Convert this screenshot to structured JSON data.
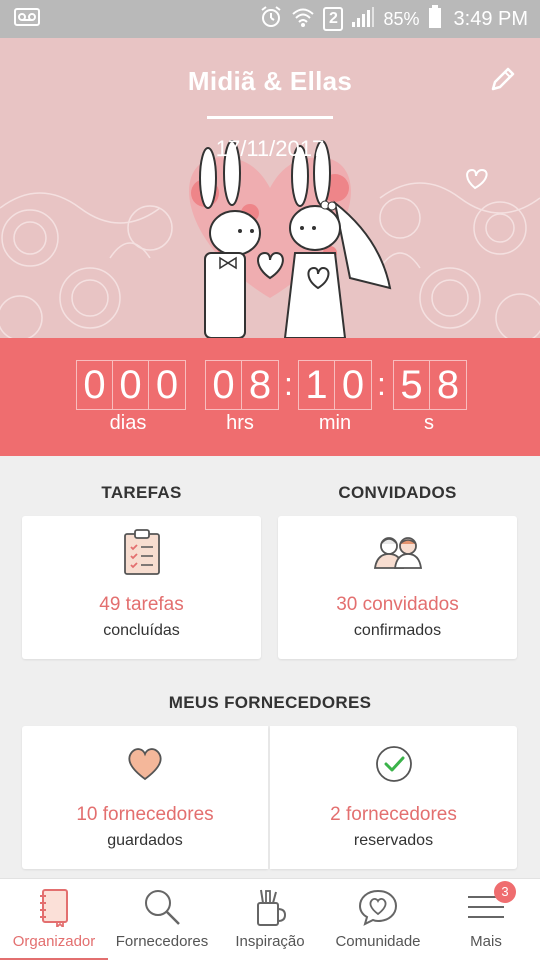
{
  "status_bar": {
    "time": "3:49 PM",
    "battery": "85%",
    "sim": "2"
  },
  "header": {
    "title": "Midiã & Ellas",
    "date": "17/11/2017"
  },
  "countdown": {
    "days": [
      "0",
      "0",
      "0"
    ],
    "hours": [
      "0",
      "8"
    ],
    "minutes": [
      "1",
      "0"
    ],
    "seconds": [
      "5",
      "8"
    ],
    "labels": {
      "days": "dias",
      "hours": "hrs",
      "minutes": "min",
      "seconds": "s"
    }
  },
  "tasks": {
    "title": "TAREFAS",
    "count": "49 tarefas",
    "status": "concluídas"
  },
  "guests": {
    "title": "CONVIDADOS",
    "count": "30 convidados",
    "status": "confirmados"
  },
  "vendors": {
    "title": "MEUS FORNECEDORES",
    "saved": {
      "count": "10 fornecedores",
      "status": "guardados"
    },
    "booked": {
      "count": "2 fornecedores",
      "status": "reservados"
    }
  },
  "nav": {
    "items": [
      {
        "label": "Organizador",
        "icon": "notebook-icon",
        "active": true
      },
      {
        "label": "Fornecedores",
        "icon": "search-icon"
      },
      {
        "label": "Inspiração",
        "icon": "pencil-cup-icon"
      },
      {
        "label": "Comunidade",
        "icon": "chat-heart-icon"
      },
      {
        "label": "Mais",
        "icon": "menu-icon",
        "badge": "3"
      }
    ]
  },
  "colors": {
    "accent": "#ef6d6f",
    "header_bg": "#e8c4c4",
    "status_bar": "#b9b9b9"
  }
}
